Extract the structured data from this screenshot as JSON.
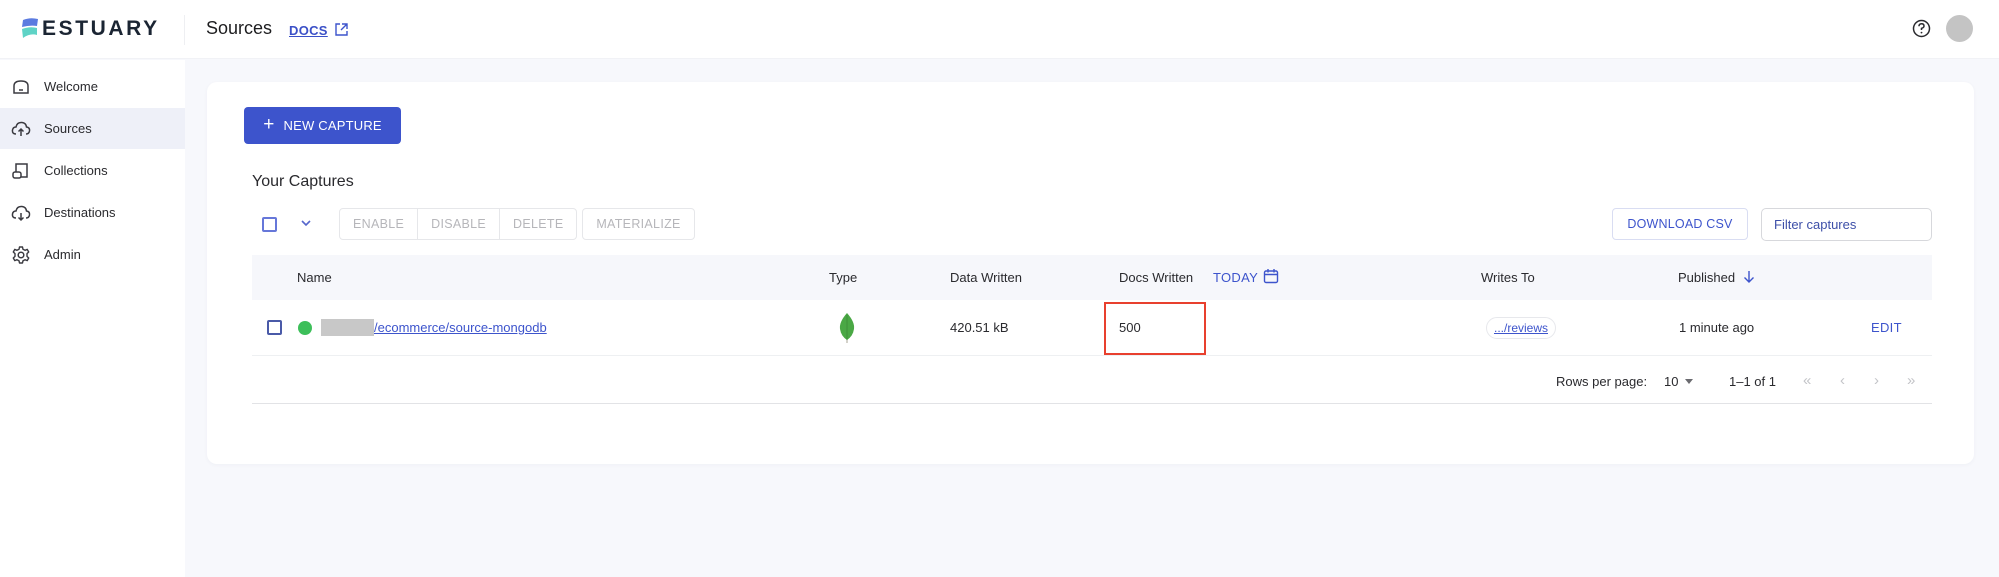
{
  "app": {
    "brand": "ESTUARY",
    "page_title": "Sources",
    "docs_link": "DOCS",
    "colors": {
      "accent": "#3d54cc",
      "status_ok": "#3dbf5a",
      "highlight": "#e8402e",
      "logo_top": "#5b7be0",
      "logo_bottom": "#5fd3c6"
    }
  },
  "header_icons": {
    "external_link": "external-link-icon",
    "help": "help-circle-icon",
    "avatar": "avatar"
  },
  "sidebar": {
    "items": [
      {
        "label": "Welcome",
        "icon": "home-icon",
        "active": false
      },
      {
        "label": "Sources",
        "icon": "cloud-upload-icon",
        "active": true
      },
      {
        "label": "Collections",
        "icon": "collections-icon",
        "active": false
      },
      {
        "label": "Destinations",
        "icon": "cloud-download-icon",
        "active": false
      },
      {
        "label": "Admin",
        "icon": "gear-icon",
        "active": false
      }
    ]
  },
  "main": {
    "new_capture_label": "NEW CAPTURE",
    "section_title": "Your Captures",
    "bulk_actions": [
      "ENABLE",
      "DISABLE",
      "DELETE"
    ],
    "materialize_label": "MATERIALIZE",
    "download_csv_label": "DOWNLOAD CSV",
    "filter_placeholder": "Filter captures",
    "table": {
      "columns": [
        "Name",
        "Type",
        "Data Written",
        "Docs Written",
        "Writes To",
        "Published"
      ],
      "docs_range_label": "TODAY",
      "published_sort": "descending",
      "rows": [
        {
          "status": "active",
          "name_visible": "/ecommerce/source-mongodb",
          "type_icon": "mongodb-leaf-icon",
          "data_written": "420.51 kB",
          "docs_written": "500",
          "writes_to": ".../reviews",
          "published": "1 minute ago",
          "action": "EDIT"
        }
      ]
    },
    "pagination": {
      "rows_per_page_label": "Rows per page:",
      "rows_per_page": "10",
      "range": "1–1 of 1",
      "first": "«",
      "prev": "‹",
      "next": "›",
      "last": "»"
    }
  }
}
